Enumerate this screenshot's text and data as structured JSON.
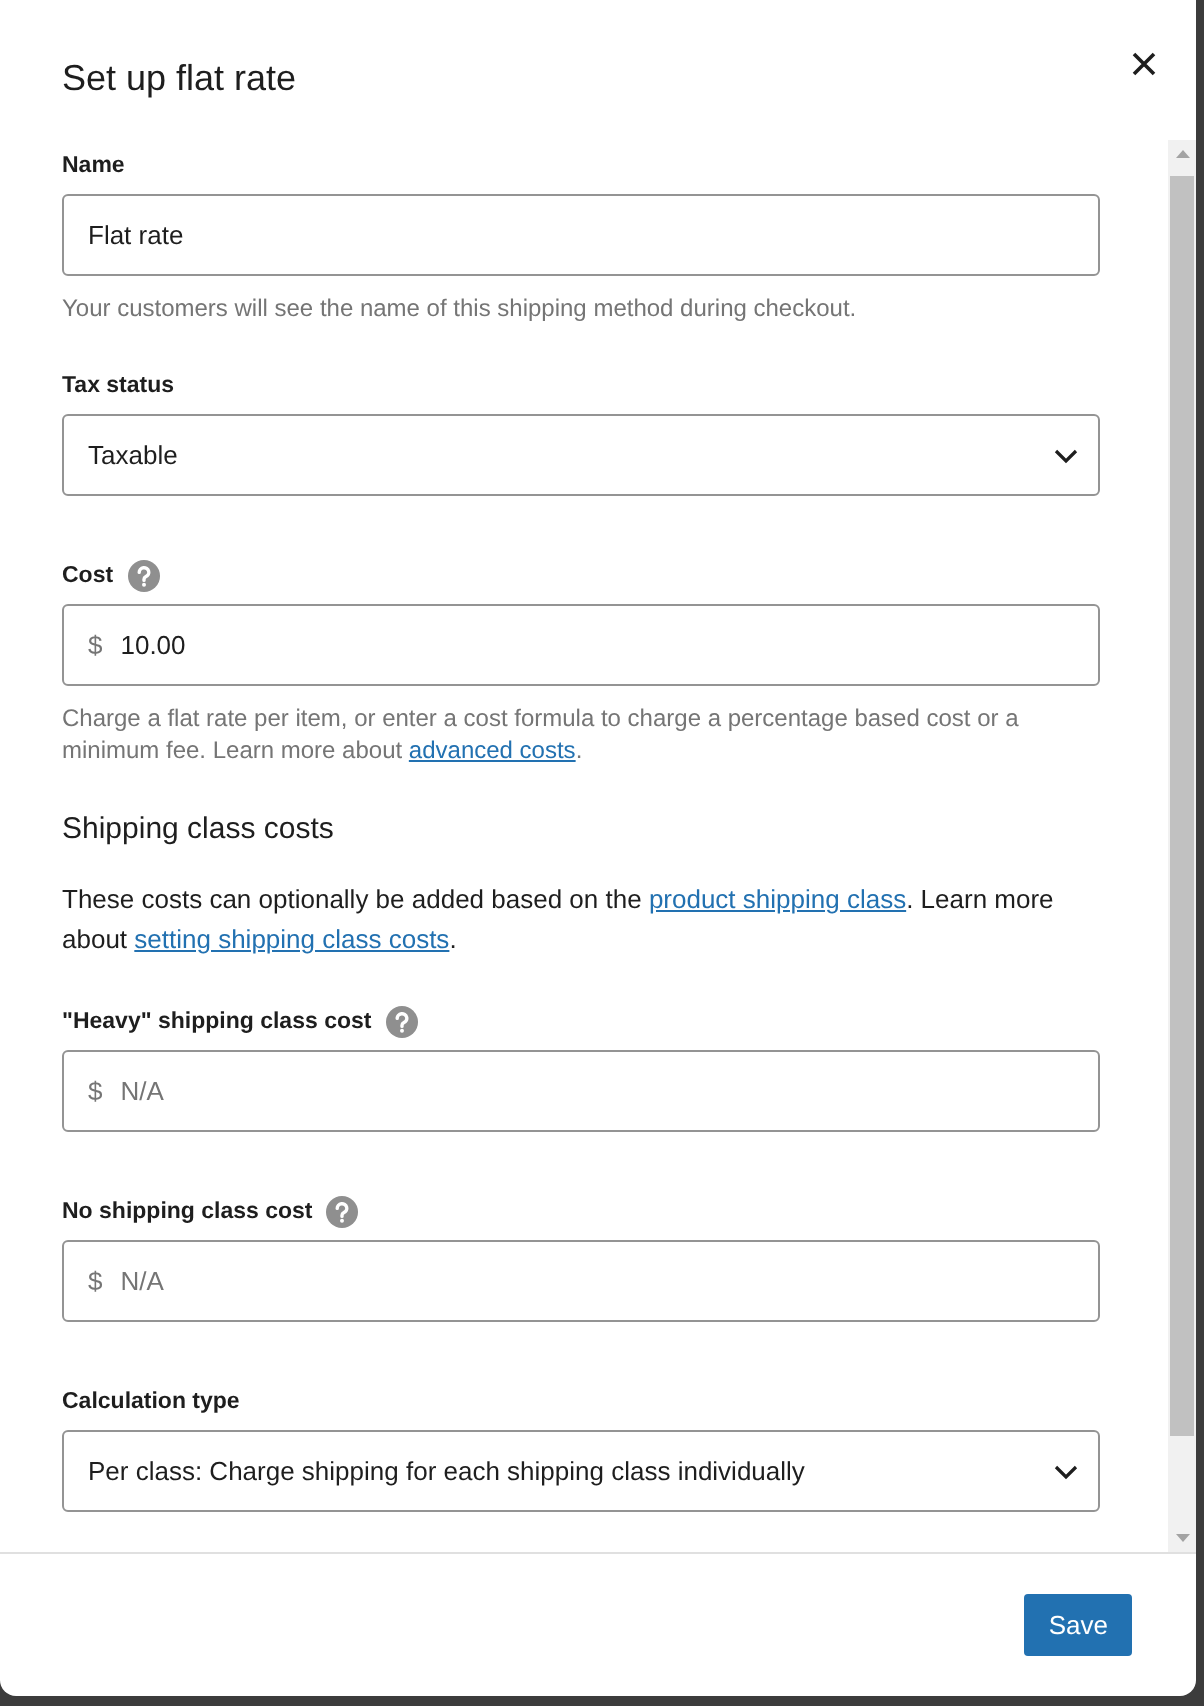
{
  "dialog": {
    "title": "Set up flat rate"
  },
  "form": [
    {
      "kind": "input",
      "label": "Name",
      "value": "Flat rate",
      "help": [
        {
          "kind": "text",
          "text": "Your customers will see the name of this shipping method during checkout."
        }
      ]
    },
    {
      "kind": "select",
      "label": "Tax status",
      "value": "Taxable"
    },
    {
      "kind": "input",
      "label": "Cost",
      "help_icon": true,
      "prefix": "$",
      "value": "10.00",
      "help": [
        {
          "kind": "text",
          "text": "Charge a flat rate per item, or enter a cost formula to charge a percentage based cost or a minimum fee. Learn more about "
        },
        {
          "kind": "link",
          "text": "advanced costs"
        },
        {
          "kind": "text",
          "text": "."
        }
      ]
    },
    {
      "kind": "heading",
      "text": "Shipping class costs"
    },
    {
      "kind": "paragraph",
      "parts": [
        {
          "kind": "text",
          "text": "These costs can optionally be added based on the "
        },
        {
          "kind": "link",
          "text": "product shipping class"
        },
        {
          "kind": "text",
          "text": ". Learn more about "
        },
        {
          "kind": "link",
          "text": "setting shipping class costs"
        },
        {
          "kind": "text",
          "text": "."
        }
      ]
    },
    {
      "kind": "input",
      "label": "\"Heavy\" shipping class cost",
      "help_icon": true,
      "prefix": "$",
      "placeholder": "N/A"
    },
    {
      "kind": "input",
      "label": "No shipping class cost",
      "help_icon": true,
      "prefix": "$",
      "placeholder": "N/A"
    },
    {
      "kind": "select",
      "label": "Calculation type",
      "value": "Per class: Charge shipping for each shipping class individually"
    }
  ],
  "footer": {
    "save_button": "Save"
  }
}
